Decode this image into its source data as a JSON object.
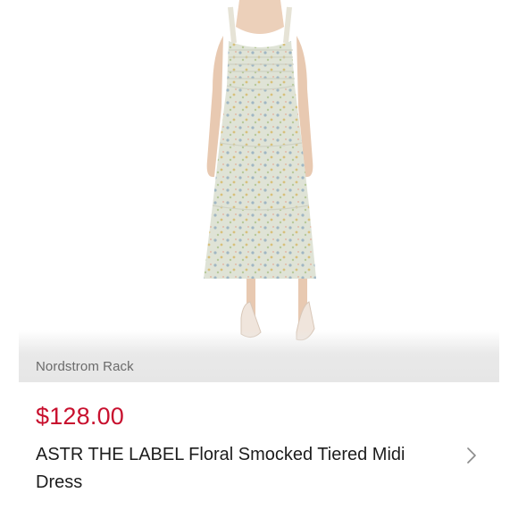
{
  "product": {
    "image_icon": "floral-midi-dress-photo",
    "seller": "Nordstrom Rack",
    "price": "$128.00",
    "title": "ASTR THE LABEL Floral Smocked Tiered Midi Dress",
    "detail_icon": "chevron-right-icon"
  },
  "colors": {
    "price": "#c8102e",
    "seller_text": "#6b6b6b",
    "title_text": "#1c1c1c",
    "seller_strip": "#e6e6e6"
  }
}
